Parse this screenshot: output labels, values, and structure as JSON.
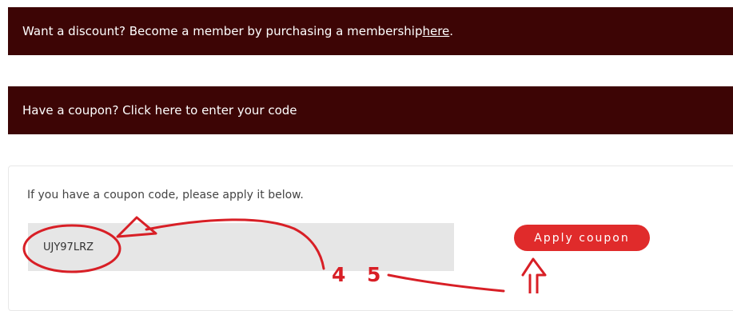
{
  "membership_notice": {
    "text": "Want a discount? Become a member by purchasing a membership ",
    "link_label": "here",
    "suffix": "."
  },
  "coupon_toggle": {
    "text": "Have a coupon? Click here to enter your code"
  },
  "coupon_form": {
    "instruction": "If you have a coupon code, please apply it below.",
    "code_value": "UJY97LRZ",
    "apply_label": "Apply coupon"
  },
  "annotations": {
    "step_a": "4",
    "step_b": "5"
  },
  "colors": {
    "notice_background": "#3d0505",
    "button_background": "#e02b2b",
    "annotation": "#d81f26",
    "input_background": "#e6e6e6"
  }
}
